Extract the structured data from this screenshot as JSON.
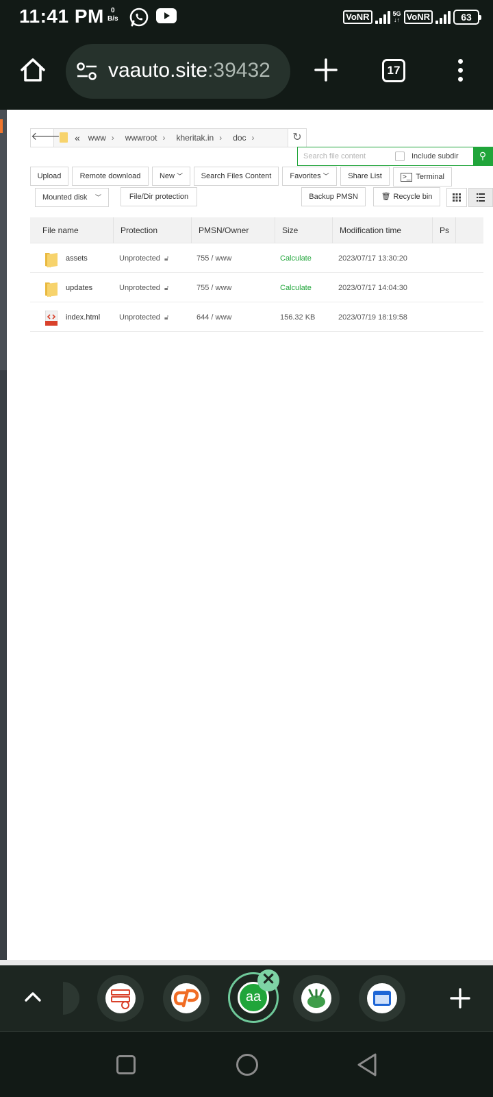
{
  "status_bar": {
    "time": "11:41 PM",
    "net_speed_value": "0",
    "net_speed_unit": "B/s",
    "network_tag_1": "VoNR",
    "network_tag_2": "VoNR",
    "gen_label": "5G",
    "battery": "63",
    "icons": [
      "whatsapp-icon",
      "youtube-icon",
      "signal-icon",
      "battery-icon"
    ]
  },
  "browser": {
    "url_domain": "vaauto.site",
    "url_port": ":39432",
    "tab_count": "17",
    "icons": [
      "home-icon",
      "site-settings-icon",
      "new-tab-icon",
      "more-icon"
    ]
  },
  "file_manager": {
    "path": {
      "double_chevron": "«",
      "crumbs": [
        "www",
        "wwwroot",
        "kheritak.in",
        "doc"
      ],
      "separator": "›"
    },
    "search": {
      "placeholder": "Search file content",
      "include_subdir_label": "Include subdir"
    },
    "toolbar": {
      "upload": "Upload",
      "remote_download": "Remote download",
      "new": "New",
      "search_files_content": "Search Files Content",
      "favorites": "Favorites",
      "share_list": "Share List",
      "terminal": "Terminal",
      "mounted_disk": "Mounted disk",
      "file_dir_protection": "File/Dir protection",
      "backup_pmsn": "Backup PMSN",
      "recycle_bin": "Recycle bin"
    },
    "table": {
      "headers": [
        "File name",
        "Protection",
        "PMSN/Owner",
        "Size",
        "Modification time",
        "Ps"
      ],
      "rows": [
        {
          "type": "folder",
          "name": "assets",
          "protection": "Unprotected",
          "pmsn": "755 / www",
          "size": "Calculate",
          "mtime": "2023/07/17 13:30:20"
        },
        {
          "type": "folder",
          "name": "updates",
          "protection": "Unprotected",
          "pmsn": "755 / www",
          "size": "Calculate",
          "mtime": "2023/07/17 14:04:30"
        },
        {
          "type": "html",
          "name": "index.html",
          "protection": "Unprotected",
          "pmsn": "644 / www",
          "size": "156.32 KB",
          "mtime": "2023/07/19 18:19:58"
        }
      ]
    }
  },
  "dock": {
    "active_label": "aa",
    "close_symbol": "✕"
  },
  "colors": {
    "accent_green": "#20a53a",
    "system_bar": "#121a16",
    "folder_yellow": "#f7d36c"
  }
}
